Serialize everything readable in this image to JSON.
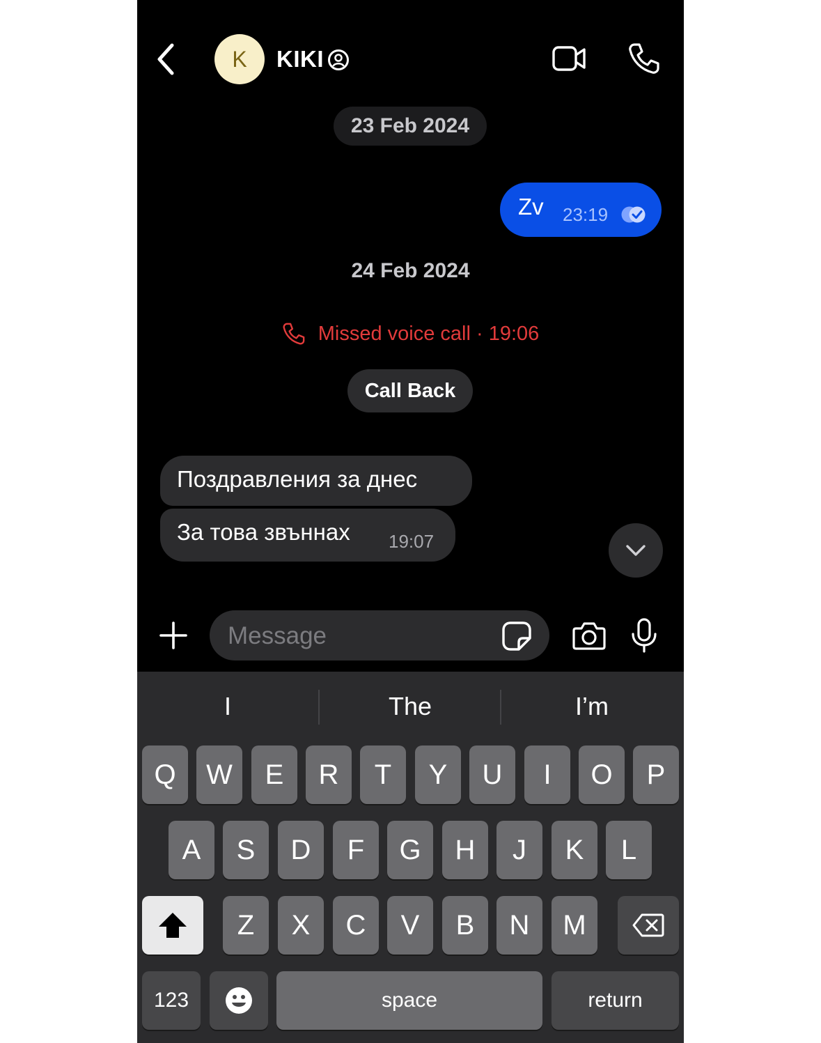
{
  "header": {
    "contact_initial": "K",
    "contact_name": "KIKI"
  },
  "chat": {
    "date_1": "23 Feb 2024",
    "outgoing": [
      {
        "text": "Zv",
        "time": "23:19"
      }
    ],
    "date_2": "24 Feb 2024",
    "missed_call": "Missed voice call · 19:06",
    "call_back_label": "Call Back",
    "incoming": [
      {
        "text": "Поздравления за днес"
      },
      {
        "text": "За това звъннах",
        "time": "19:07"
      }
    ]
  },
  "composer": {
    "placeholder": "Message"
  },
  "keyboard": {
    "suggestions": [
      "I",
      "The",
      "I’m"
    ],
    "row1": [
      "Q",
      "W",
      "E",
      "R",
      "T",
      "Y",
      "U",
      "I",
      "O",
      "P"
    ],
    "row2": [
      "A",
      "S",
      "D",
      "F",
      "G",
      "H",
      "J",
      "K",
      "L"
    ],
    "row3": [
      "Z",
      "X",
      "C",
      "V",
      "B",
      "N",
      "M"
    ],
    "numbers_label": "123",
    "space_label": "space",
    "return_label": "return"
  },
  "colors": {
    "outgoing_bubble": "#0a4fe6",
    "incoming_bubble": "#2c2c2e",
    "missed_call": "#e23b3b",
    "avatar_bg": "#f8efc9"
  }
}
